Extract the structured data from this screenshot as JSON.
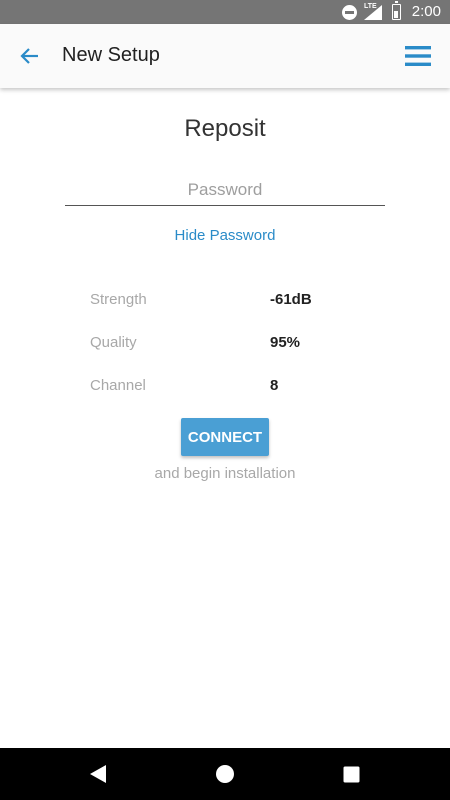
{
  "status_bar": {
    "time": "2:00",
    "network_label": "LTE",
    "icons": [
      "do-not-disturb-icon",
      "signal-icon",
      "battery-icon"
    ]
  },
  "app_bar": {
    "title": "New Setup",
    "back_icon": "arrow-back-icon",
    "menu_icon": "hamburger-menu-icon"
  },
  "network": {
    "name": "Reposit"
  },
  "password": {
    "value": "",
    "placeholder": "Password",
    "toggle_label": "Hide Password"
  },
  "stats": [
    {
      "label": "Strength",
      "value": "-61dB"
    },
    {
      "label": "Quality",
      "value": "95%"
    },
    {
      "label": "Channel",
      "value": "8"
    }
  ],
  "connect": {
    "button_label": "CONNECT",
    "caption": "and begin installation"
  },
  "nav_bar": {
    "icons": [
      "back-triangle-icon",
      "home-circle-icon",
      "recents-square-icon"
    ]
  },
  "colors": {
    "accent": "#2a8bc8",
    "button": "#4a9fd4",
    "status_bar": "#757575",
    "muted_text": "#a8a8a8"
  }
}
